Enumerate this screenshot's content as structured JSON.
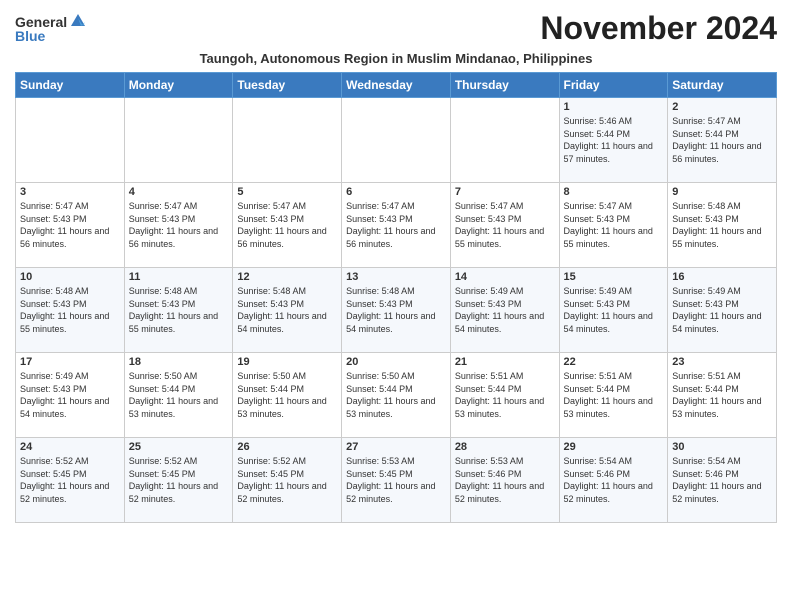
{
  "logo": {
    "text_general": "General",
    "text_blue": "Blue"
  },
  "title": "November 2024",
  "subtitle": "Taungoh, Autonomous Region in Muslim Mindanao, Philippines",
  "headers": [
    "Sunday",
    "Monday",
    "Tuesday",
    "Wednesday",
    "Thursday",
    "Friday",
    "Saturday"
  ],
  "weeks": [
    [
      {
        "day": "",
        "sunrise": "",
        "sunset": "",
        "daylight": ""
      },
      {
        "day": "",
        "sunrise": "",
        "sunset": "",
        "daylight": ""
      },
      {
        "day": "",
        "sunrise": "",
        "sunset": "",
        "daylight": ""
      },
      {
        "day": "",
        "sunrise": "",
        "sunset": "",
        "daylight": ""
      },
      {
        "day": "",
        "sunrise": "",
        "sunset": "",
        "daylight": ""
      },
      {
        "day": "1",
        "sunrise": "Sunrise: 5:46 AM",
        "sunset": "Sunset: 5:44 PM",
        "daylight": "Daylight: 11 hours and 57 minutes."
      },
      {
        "day": "2",
        "sunrise": "Sunrise: 5:47 AM",
        "sunset": "Sunset: 5:44 PM",
        "daylight": "Daylight: 11 hours and 56 minutes."
      }
    ],
    [
      {
        "day": "3",
        "sunrise": "Sunrise: 5:47 AM",
        "sunset": "Sunset: 5:43 PM",
        "daylight": "Daylight: 11 hours and 56 minutes."
      },
      {
        "day": "4",
        "sunrise": "Sunrise: 5:47 AM",
        "sunset": "Sunset: 5:43 PM",
        "daylight": "Daylight: 11 hours and 56 minutes."
      },
      {
        "day": "5",
        "sunrise": "Sunrise: 5:47 AM",
        "sunset": "Sunset: 5:43 PM",
        "daylight": "Daylight: 11 hours and 56 minutes."
      },
      {
        "day": "6",
        "sunrise": "Sunrise: 5:47 AM",
        "sunset": "Sunset: 5:43 PM",
        "daylight": "Daylight: 11 hours and 56 minutes."
      },
      {
        "day": "7",
        "sunrise": "Sunrise: 5:47 AM",
        "sunset": "Sunset: 5:43 PM",
        "daylight": "Daylight: 11 hours and 55 minutes."
      },
      {
        "day": "8",
        "sunrise": "Sunrise: 5:47 AM",
        "sunset": "Sunset: 5:43 PM",
        "daylight": "Daylight: 11 hours and 55 minutes."
      },
      {
        "day": "9",
        "sunrise": "Sunrise: 5:48 AM",
        "sunset": "Sunset: 5:43 PM",
        "daylight": "Daylight: 11 hours and 55 minutes."
      }
    ],
    [
      {
        "day": "10",
        "sunrise": "Sunrise: 5:48 AM",
        "sunset": "Sunset: 5:43 PM",
        "daylight": "Daylight: 11 hours and 55 minutes."
      },
      {
        "day": "11",
        "sunrise": "Sunrise: 5:48 AM",
        "sunset": "Sunset: 5:43 PM",
        "daylight": "Daylight: 11 hours and 55 minutes."
      },
      {
        "day": "12",
        "sunrise": "Sunrise: 5:48 AM",
        "sunset": "Sunset: 5:43 PM",
        "daylight": "Daylight: 11 hours and 54 minutes."
      },
      {
        "day": "13",
        "sunrise": "Sunrise: 5:48 AM",
        "sunset": "Sunset: 5:43 PM",
        "daylight": "Daylight: 11 hours and 54 minutes."
      },
      {
        "day": "14",
        "sunrise": "Sunrise: 5:49 AM",
        "sunset": "Sunset: 5:43 PM",
        "daylight": "Daylight: 11 hours and 54 minutes."
      },
      {
        "day": "15",
        "sunrise": "Sunrise: 5:49 AM",
        "sunset": "Sunset: 5:43 PM",
        "daylight": "Daylight: 11 hours and 54 minutes."
      },
      {
        "day": "16",
        "sunrise": "Sunrise: 5:49 AM",
        "sunset": "Sunset: 5:43 PM",
        "daylight": "Daylight: 11 hours and 54 minutes."
      }
    ],
    [
      {
        "day": "17",
        "sunrise": "Sunrise: 5:49 AM",
        "sunset": "Sunset: 5:43 PM",
        "daylight": "Daylight: 11 hours and 54 minutes."
      },
      {
        "day": "18",
        "sunrise": "Sunrise: 5:50 AM",
        "sunset": "Sunset: 5:44 PM",
        "daylight": "Daylight: 11 hours and 53 minutes."
      },
      {
        "day": "19",
        "sunrise": "Sunrise: 5:50 AM",
        "sunset": "Sunset: 5:44 PM",
        "daylight": "Daylight: 11 hours and 53 minutes."
      },
      {
        "day": "20",
        "sunrise": "Sunrise: 5:50 AM",
        "sunset": "Sunset: 5:44 PM",
        "daylight": "Daylight: 11 hours and 53 minutes."
      },
      {
        "day": "21",
        "sunrise": "Sunrise: 5:51 AM",
        "sunset": "Sunset: 5:44 PM",
        "daylight": "Daylight: 11 hours and 53 minutes."
      },
      {
        "day": "22",
        "sunrise": "Sunrise: 5:51 AM",
        "sunset": "Sunset: 5:44 PM",
        "daylight": "Daylight: 11 hours and 53 minutes."
      },
      {
        "day": "23",
        "sunrise": "Sunrise: 5:51 AM",
        "sunset": "Sunset: 5:44 PM",
        "daylight": "Daylight: 11 hours and 53 minutes."
      }
    ],
    [
      {
        "day": "24",
        "sunrise": "Sunrise: 5:52 AM",
        "sunset": "Sunset: 5:45 PM",
        "daylight": "Daylight: 11 hours and 52 minutes."
      },
      {
        "day": "25",
        "sunrise": "Sunrise: 5:52 AM",
        "sunset": "Sunset: 5:45 PM",
        "daylight": "Daylight: 11 hours and 52 minutes."
      },
      {
        "day": "26",
        "sunrise": "Sunrise: 5:52 AM",
        "sunset": "Sunset: 5:45 PM",
        "daylight": "Daylight: 11 hours and 52 minutes."
      },
      {
        "day": "27",
        "sunrise": "Sunrise: 5:53 AM",
        "sunset": "Sunset: 5:45 PM",
        "daylight": "Daylight: 11 hours and 52 minutes."
      },
      {
        "day": "28",
        "sunrise": "Sunrise: 5:53 AM",
        "sunset": "Sunset: 5:46 PM",
        "daylight": "Daylight: 11 hours and 52 minutes."
      },
      {
        "day": "29",
        "sunrise": "Sunrise: 5:54 AM",
        "sunset": "Sunset: 5:46 PM",
        "daylight": "Daylight: 11 hours and 52 minutes."
      },
      {
        "day": "30",
        "sunrise": "Sunrise: 5:54 AM",
        "sunset": "Sunset: 5:46 PM",
        "daylight": "Daylight: 11 hours and 52 minutes."
      }
    ]
  ]
}
